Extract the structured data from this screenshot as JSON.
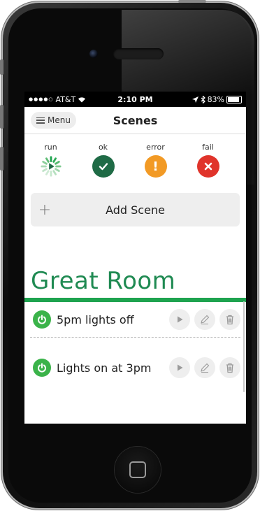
{
  "status_bar": {
    "carrier": "AT&T",
    "time": "2:10 PM",
    "battery": "83%"
  },
  "navbar": {
    "menu_label": "Menu",
    "title": "Scenes"
  },
  "legend": {
    "run": "run",
    "ok": "ok",
    "error": "error",
    "fail": "fail"
  },
  "add_scene": {
    "label": "Add Scene",
    "plus": "+"
  },
  "room": {
    "name": "Great Room",
    "scenes": [
      {
        "name": "5pm lights off"
      },
      {
        "name": "Lights on at 3pm"
      }
    ]
  },
  "colors": {
    "accent_green": "#1ea34f",
    "room_title": "#1f8a52",
    "ok": "#1f6b46",
    "error": "#f29a25",
    "fail": "#e0342b",
    "power": "#3bb34a"
  },
  "icons": [
    "hamburger-icon",
    "spinner-icon",
    "check-icon",
    "exclamation-icon",
    "x-icon",
    "plus-icon",
    "power-icon",
    "play-icon",
    "edit-icon",
    "trash-icon",
    "wifi-icon",
    "location-icon",
    "bluetooth-icon",
    "battery-icon"
  ]
}
